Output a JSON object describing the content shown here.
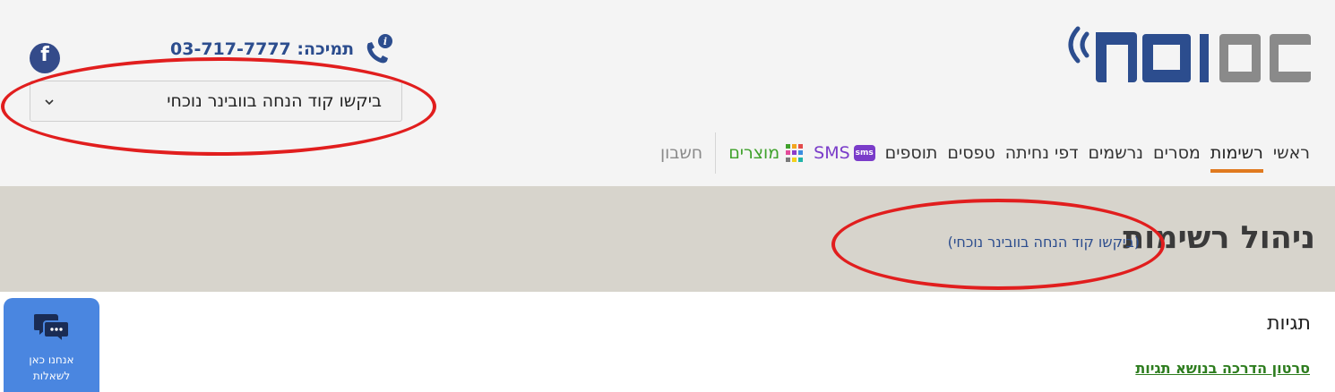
{
  "brand": {
    "logo_text": "רב מסר",
    "icon": "signal-waves-icon"
  },
  "support": {
    "label": "תמיכה: 03-717-7777",
    "icon": "phone-info-icon"
  },
  "social": {
    "facebook_glyph": "f",
    "icon": "facebook-icon"
  },
  "list_selector": {
    "value": "ביקשו קוד הנחה בוובינר נוכחי",
    "icon": "chevron-down-icon"
  },
  "nav": {
    "items": [
      "ראשי",
      "רשימות",
      "מסרים",
      "נרשמים",
      "דפי נחיתה",
      "טפסים",
      "תוספים"
    ],
    "active_index": 1,
    "sms_label": "SMS",
    "sms_badge": "sms",
    "products_label": "מוצרים",
    "account_label": "חשבון"
  },
  "page": {
    "title": "ניהול רשימות",
    "subtitle": "(ביקשו קוד הנחה בוובינר נוכחי)"
  },
  "tags": {
    "title": "תגיות",
    "video_link": "סרטון הדרכה בנושא תגיות"
  },
  "chat_widget": {
    "label_line1": "אנחנו כאן",
    "label_line2": "לשאלות",
    "icon": "chat-bubbles-icon"
  },
  "colors": {
    "accent": "#e07a1f",
    "brand_blue": "#2c4d8e",
    "annotation_red": "#e11e1e",
    "chat_blue": "#4a86e0",
    "link_green": "#2e7d1f"
  }
}
